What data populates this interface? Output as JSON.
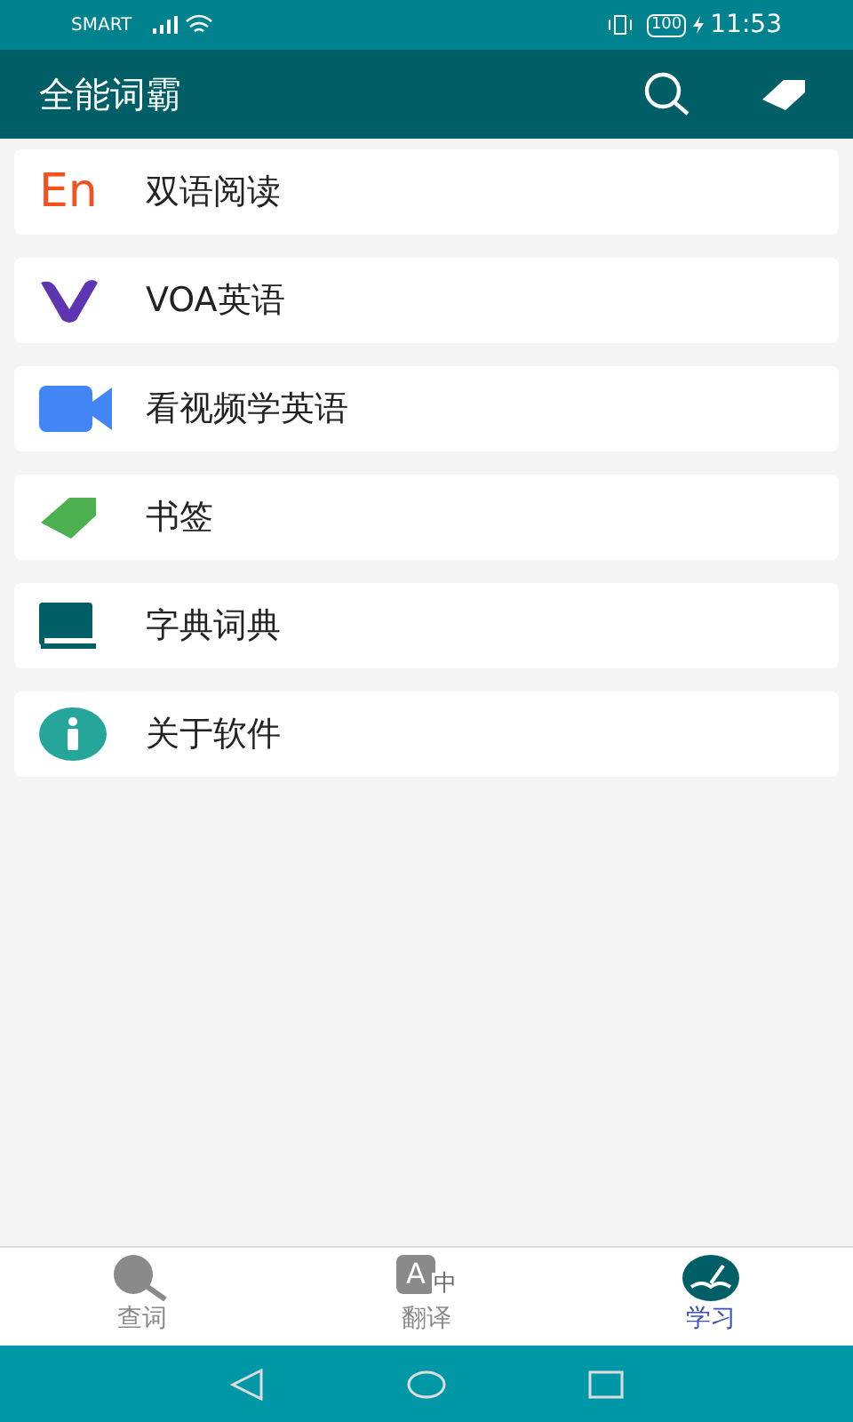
{
  "status_bar": {
    "carrier": "SMART",
    "battery": "100",
    "time": "11:53"
  },
  "app_bar": {
    "title": "全能词霸"
  },
  "menu_items": [
    {
      "kind": "en",
      "icon_text": "En",
      "label": "双语阅读"
    },
    {
      "kind": "voa",
      "label": "VOA英语"
    },
    {
      "kind": "video",
      "label": "看视频学英语"
    },
    {
      "kind": "bookmark",
      "label": "书签"
    },
    {
      "kind": "book",
      "label": "字典词典"
    },
    {
      "kind": "info",
      "label": "关于软件"
    }
  ],
  "bottom_tabs": [
    {
      "kind": "lookup",
      "label": "查词",
      "selected": false
    },
    {
      "kind": "translate",
      "icon_text": [
        "A",
        "中"
      ],
      "label": "翻译",
      "selected": false
    },
    {
      "kind": "study",
      "label": "学习",
      "selected": true
    }
  ]
}
